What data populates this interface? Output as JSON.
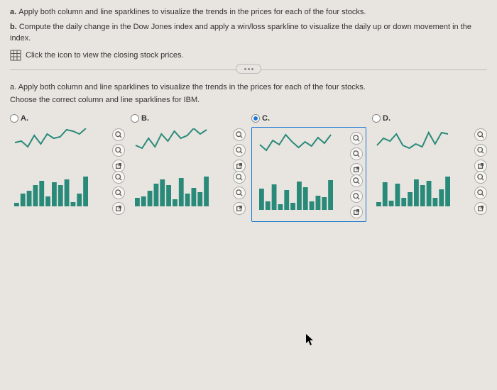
{
  "q_a_prefix": "a. ",
  "q_a_text": "Apply both column and line sparklines to visualize the trends in the prices for each of the four stocks.",
  "q_b_prefix": "b. ",
  "q_b_text": "Compute the daily change in the Dow Jones index and apply a win/loss sparkline to visualize the daily up or down movement in the index.",
  "icon_text": "Click the icon to view the closing stock prices.",
  "sub_q": "a. Apply both column and line sparklines to visualize the trends in the prices for each of the four stocks.",
  "choose_text": "Choose the correct column and line sparklines for IBM.",
  "options": {
    "a": {
      "label": "A."
    },
    "b": {
      "label": "B."
    },
    "c": {
      "label": "C."
    },
    "d": {
      "label": "D."
    }
  },
  "chart_data": [
    {
      "type": "line",
      "option": "A",
      "kind": "line_spark",
      "values": [
        28,
        30,
        22,
        38,
        26,
        40,
        34,
        36,
        46,
        44,
        40,
        48
      ]
    },
    {
      "type": "bar",
      "option": "A",
      "kind": "column_spark",
      "values": [
        5,
        18,
        22,
        30,
        36,
        14,
        34,
        30,
        38,
        6,
        18,
        42
      ]
    },
    {
      "type": "line",
      "option": "B",
      "kind": "line_spark",
      "values": [
        24,
        20,
        34,
        22,
        40,
        30,
        44,
        34,
        38,
        48,
        40,
        46
      ]
    },
    {
      "type": "bar",
      "option": "B",
      "kind": "column_spark",
      "values": [
        12,
        14,
        22,
        32,
        38,
        30,
        10,
        40,
        18,
        26,
        20,
        42
      ]
    },
    {
      "type": "line",
      "option": "C",
      "kind": "line_spark",
      "values": [
        30,
        22,
        36,
        30,
        44,
        34,
        26,
        34,
        28,
        40,
        32,
        44
      ]
    },
    {
      "type": "bar",
      "option": "C",
      "kind": "column_spark",
      "values": [
        30,
        12,
        36,
        8,
        28,
        10,
        40,
        32,
        12,
        20,
        18,
        42
      ]
    },
    {
      "type": "line",
      "option": "D",
      "kind": "line_spark",
      "values": [
        24,
        34,
        30,
        40,
        24,
        20,
        26,
        22,
        42,
        26,
        42,
        40
      ]
    },
    {
      "type": "bar",
      "option": "D",
      "kind": "column_spark",
      "values": [
        6,
        34,
        8,
        32,
        12,
        20,
        38,
        30,
        36,
        12,
        24,
        42
      ]
    }
  ]
}
